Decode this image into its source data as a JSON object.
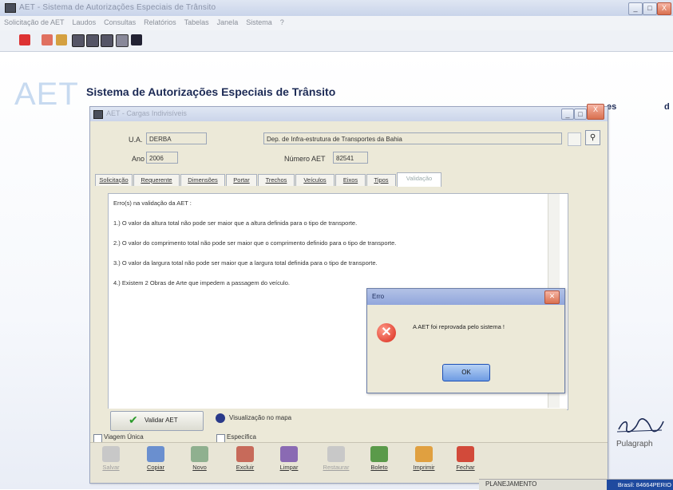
{
  "window": {
    "title": "AET - Sistema de Autorizações Especiais de Trânsito",
    "controls": [
      "_",
      "□",
      "X"
    ]
  },
  "menu": [
    "Solicitação de AET",
    "Laudos",
    "Consultas",
    "Relatórios",
    "Tabelas",
    "Janela",
    "Sistema",
    "?"
  ],
  "toolbar_icons": [
    "pin-icon",
    "pencil-icon",
    "pencil-edit-icon",
    "grid-icon",
    "grid-icon",
    "grid-icon",
    "print-icon",
    "exit-icon"
  ],
  "branding": {
    "logo": "AET",
    "system_title": "Sistema de Autorizações Especiais de Trânsito",
    "right_fragment_1": "es",
    "right_fragment_2": "d"
  },
  "child_window": {
    "title": "AET - Cargas Indivisíveis",
    "controls": [
      "_",
      "□",
      "X"
    ],
    "ua_label": "U.A.",
    "ua_value": "DERBA",
    "ua_description": "Dep. de Infra-estrutura de Transportes da Bahia",
    "ano_label": "Ano",
    "ano_value": "2006",
    "numero_label": "Número AET",
    "numero_value": "82541"
  },
  "tabs": [
    "Solicitação",
    "Requerente",
    "Dimensões",
    "Portar",
    "Trechos",
    "Veículos",
    "Eixos",
    "Tipos",
    "Validação"
  ],
  "validation": {
    "header": "Erro(s) na validação da AET :",
    "lines": [
      "1.) O valor da altura total não pode ser maior que a altura definida para o tipo de transporte.",
      "2.) O valor do comprimento total não pode ser maior que o comprimento definido para o tipo de transporte.",
      "3.) O valor da largura total não pode ser maior que a largura total definida para o tipo de transporte.",
      "4.) Existem 2 Obras de Arte que impedem a passagem do veículo."
    ],
    "validate_button": "Validar AET",
    "map_link": "Visualização no mapa"
  },
  "checkboxes": {
    "viagem_unica": "Viagem Única",
    "especifica": "Específica"
  },
  "bottom_toolbar": [
    {
      "label": "Salvar",
      "icon": "save-icon",
      "enabled": false
    },
    {
      "label": "Copiar",
      "icon": "copy-icon",
      "enabled": true
    },
    {
      "label": "Novo",
      "icon": "new-icon",
      "enabled": true
    },
    {
      "label": "Excluir",
      "icon": "delete-icon",
      "enabled": true
    },
    {
      "label": "Limpar",
      "icon": "clear-icon",
      "enabled": true
    },
    {
      "label": "Restaurar",
      "icon": "restore-icon",
      "enabled": false
    },
    {
      "label": "Boleto",
      "icon": "boleto-icon",
      "enabled": true
    },
    {
      "label": "Imprimir",
      "icon": "print-icon",
      "enabled": true
    },
    {
      "label": "Fechar",
      "icon": "close-icon",
      "enabled": true
    }
  ],
  "error_dialog": {
    "title": "Erro",
    "message": "A AET foi reprovada pelo sistema !",
    "ok_label": "OK"
  },
  "pulagraph": {
    "name": "Pulagraph"
  },
  "status_bar": {
    "left_text": "PLANEJAMENTO",
    "right_text": "Brasil: 84664PERIO"
  },
  "colors": {
    "title_blue": "#1c2a55",
    "error_red": "#d8281a",
    "ok_blue": "#6d9be3",
    "dialog_bg": "#ece9d8"
  }
}
